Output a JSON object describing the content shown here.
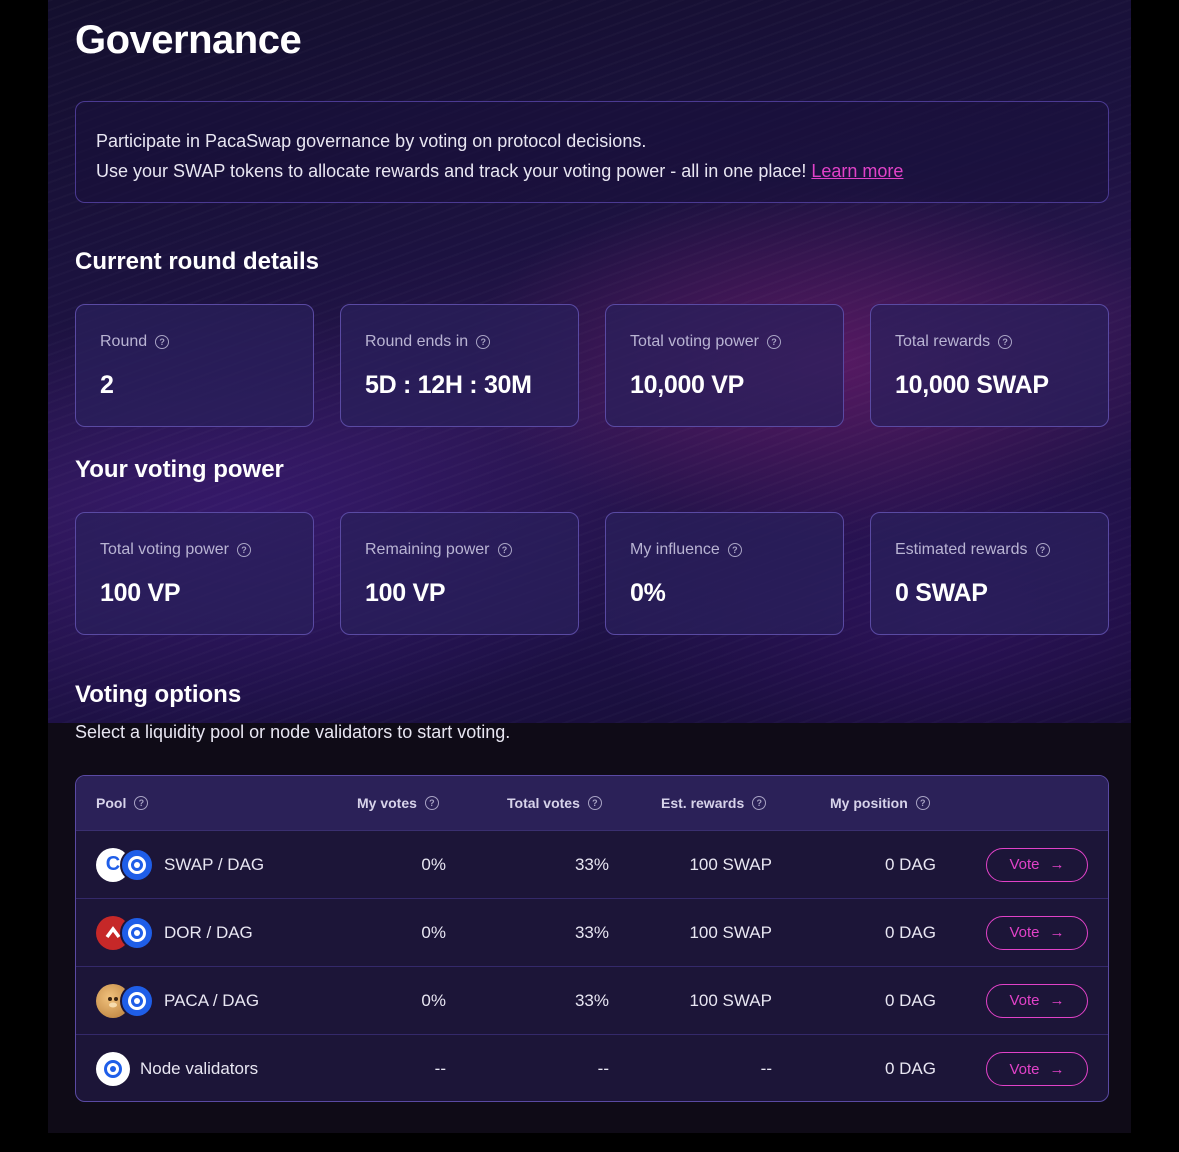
{
  "page": {
    "title": "Governance"
  },
  "intro": {
    "line1": "Participate in PacaSwap governance by voting on protocol decisions.",
    "line2": "Use your SWAP tokens to allocate rewards and track your voting power - all in one place!",
    "link": "Learn more"
  },
  "current_round": {
    "title": "Current round details",
    "cards": [
      {
        "label": "Round",
        "value": "2"
      },
      {
        "label": "Round ends in",
        "value": "5D : 12H : 30M"
      },
      {
        "label": "Total voting power",
        "value": "10,000 VP"
      },
      {
        "label": "Total rewards",
        "value": "10,000 SWAP"
      }
    ]
  },
  "voting_power": {
    "title": "Your voting power",
    "cards": [
      {
        "label": "Total voting power",
        "value": "100 VP"
      },
      {
        "label": "Remaining power",
        "value": "100 VP"
      },
      {
        "label": "My influence",
        "value": "0%"
      },
      {
        "label": "Estimated rewards",
        "value": "0 SWAP"
      }
    ]
  },
  "voting_options": {
    "title": "Voting options",
    "subtitle": "Select a liquidity pool or node validators to start voting.",
    "columns": {
      "pool": "Pool",
      "my_votes": "My votes",
      "total_votes": "Total votes",
      "est_rewards": "Est. rewards",
      "my_position": "My position"
    },
    "rows": [
      {
        "pool": "SWAP / DAG",
        "my_votes": "0%",
        "total_votes": "33%",
        "est_rewards": "100 SWAP",
        "my_position": "0 DAG",
        "action": "Vote"
      },
      {
        "pool": "DOR / DAG",
        "my_votes": "0%",
        "total_votes": "33%",
        "est_rewards": "100 SWAP",
        "my_position": "0 DAG",
        "action": "Vote"
      },
      {
        "pool": "PACA / DAG",
        "my_votes": "0%",
        "total_votes": "33%",
        "est_rewards": "100 SWAP",
        "my_position": "0 DAG",
        "action": "Vote"
      },
      {
        "pool": "Node validators",
        "my_votes": "--",
        "total_votes": "--",
        "est_rewards": "--",
        "my_position": "0 DAG",
        "action": "Vote"
      }
    ]
  },
  "colors": {
    "accent": "#e142c8",
    "card_border": "#5a4aa3",
    "dag_blue": "#1f5ee8"
  },
  "icons": {
    "help": "question-circle-icon",
    "arrow": "arrow-right-icon"
  }
}
